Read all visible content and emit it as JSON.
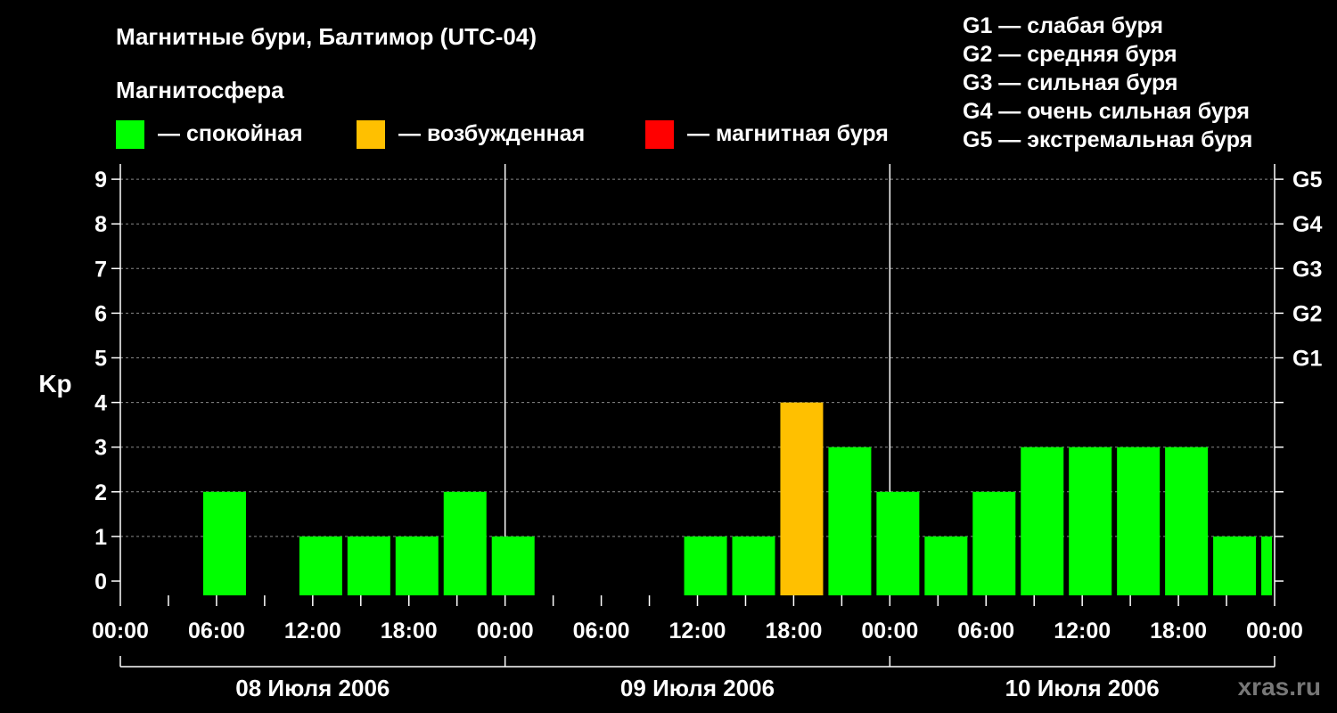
{
  "chart_data": {
    "type": "bar",
    "title": "Магнитные бури, Балтимор (UTC-04)",
    "ylabel": "Kp",
    "ylim": [
      0,
      9
    ],
    "y_ticks": [
      "0",
      "1",
      "2",
      "3",
      "4",
      "5",
      "6",
      "7",
      "8",
      "9"
    ],
    "storm_levels": [
      {
        "kp": 5,
        "label": "G1"
      },
      {
        "kp": 6,
        "label": "G2"
      },
      {
        "kp": 7,
        "label": "G3"
      },
      {
        "kp": 8,
        "label": "G4"
      },
      {
        "kp": 9,
        "label": "G5"
      }
    ],
    "x_tick_labels": [
      "00:00",
      "06:00",
      "12:00",
      "18:00",
      "00:00",
      "06:00",
      "12:00",
      "18:00",
      "00:00",
      "06:00",
      "12:00",
      "18:00",
      "00:00"
    ],
    "days": [
      "08 Июля 2006",
      "09 Июля 2006",
      "10 Июля 2006"
    ],
    "bar_interval_hours": 3,
    "values": [
      0,
      2,
      0,
      1,
      1,
      1,
      2,
      1,
      0,
      0,
      0,
      1,
      1,
      4,
      3,
      2,
      1,
      2,
      3,
      3,
      3,
      3,
      1,
      1
    ],
    "status": [
      "calm",
      "calm",
      "calm",
      "calm",
      "calm",
      "calm",
      "calm",
      "calm",
      "calm",
      "calm",
      "calm",
      "calm",
      "calm",
      "excited",
      "calm",
      "calm",
      "calm",
      "calm",
      "calm",
      "calm",
      "calm",
      "calm",
      "calm",
      "calm"
    ],
    "grid": true,
    "last_bar_partial": true
  },
  "legend": {
    "heading": "Магнитосфера",
    "items": [
      {
        "key": "calm",
        "label": "— спокойная",
        "color": "#00ff00"
      },
      {
        "key": "excited",
        "label": "— возбужденная",
        "color": "#ffc000"
      },
      {
        "key": "storm",
        "label": "— магнитная буря",
        "color": "#ff0000"
      }
    ]
  },
  "storm_scale": [
    "G1 — слабая буря",
    "G2 — средняя буря",
    "G3 — сильная буря",
    "G4 — очень сильная буря",
    "G5 — экстремальная буря"
  ],
  "watermark": "xras.ru"
}
